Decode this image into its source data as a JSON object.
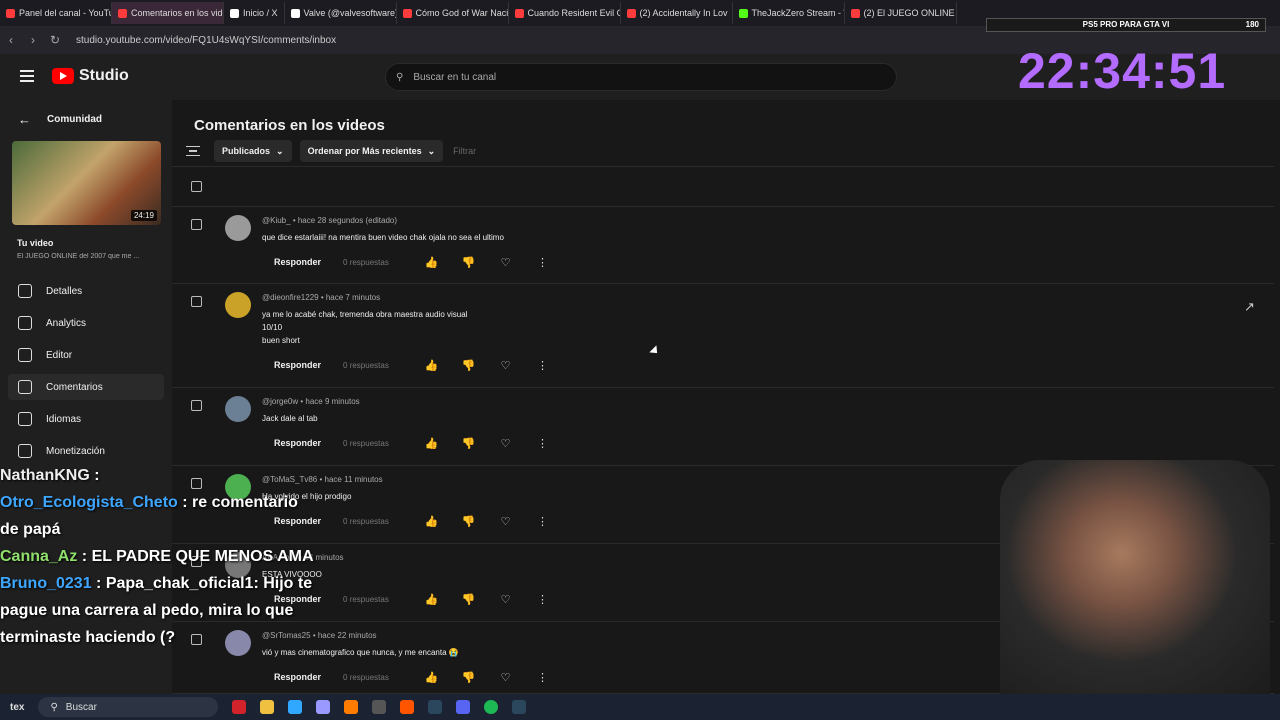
{
  "browser": {
    "tabs": [
      {
        "label": "Panel del canal - YouTube",
        "color": "#ff3b3b",
        "active": false
      },
      {
        "label": "Comentarios en los videos",
        "color": "#ff3b3b",
        "active": true
      },
      {
        "label": "Inicio / X",
        "color": "#ffffff",
        "active": false
      },
      {
        "label": "Valve (@valvesoftware) / X",
        "color": "#ffffff",
        "active": false
      },
      {
        "label": "Cómo God of War Nació",
        "color": "#ff3b3b",
        "active": false
      },
      {
        "label": "Cuando Resident Evil Cas",
        "color": "#ff3b3b",
        "active": false
      },
      {
        "label": "(2) Accidentally In Lov",
        "color": "#ff3b3b",
        "active": false
      },
      {
        "label": "TheJackZero Stream - Wa",
        "color": "#53fc18",
        "active": false
      },
      {
        "label": "(2) El JUEGO ONLINE del",
        "color": "#ff3b3b",
        "active": false
      }
    ],
    "url": "studio.youtube.com/video/FQ1U4sWqYSI/comments/inbox"
  },
  "topbar": {
    "logo_text": "Studio",
    "search_placeholder": "Buscar en tu canal"
  },
  "overlay": {
    "clock": "22:34:51",
    "banner": "PS5 PRO PARA GTA VI",
    "banner_count": "180"
  },
  "sidebar": {
    "back_label": "Comunidad",
    "thumb_duration": "24:19",
    "your_video_label": "Tu video",
    "video_title": "El JUEGO ONLINE del 2007 que me ...",
    "items": [
      {
        "label": "Detalles",
        "icon": "pencil-icon",
        "active": false
      },
      {
        "label": "Analytics",
        "icon": "analytics-icon",
        "active": false
      },
      {
        "label": "Editor",
        "icon": "editor-icon",
        "active": false
      },
      {
        "label": "Comentarios",
        "icon": "comment-icon",
        "active": true
      },
      {
        "label": "Idiomas",
        "icon": "languages-icon",
        "active": false
      },
      {
        "label": "Monetización",
        "icon": "dollar-icon",
        "active": false
      }
    ]
  },
  "main": {
    "title": "Comentarios en los videos",
    "chip_published": "Publicados",
    "chip_sort": "Ordenar por Más recientes",
    "filter_placeholder": "Filtrar",
    "reply_label": "Responder",
    "comments": [
      {
        "author": "@Kiub_",
        "time": "hace 28 segundos (editado)",
        "lines": [
          "que dice estarlaiii! na mentira buen video chak ojala no sea el ultimo"
        ],
        "replies": "0 respuestas",
        "avatar_color": "#9a9a9a"
      },
      {
        "author": "@dieonfire1229",
        "time": "hace 7 minutos",
        "lines": [
          "ya me lo acabé chak, tremenda obra maestra audio visual",
          "10/10",
          "buen short"
        ],
        "replies": "0 respuestas",
        "avatar_color": "#c9a227"
      },
      {
        "author": "@jorge0w",
        "time": "hace 9 minutos",
        "lines": [
          "Jack dale al tab"
        ],
        "replies": "0 respuestas",
        "avatar_color": "#6b7f95"
      },
      {
        "author": "@ToMaS_Tv86",
        "time": "hace 11 minutos",
        "lines": [
          "Ha volvido el hijo prodigo"
        ],
        "replies": "0 respuestas",
        "avatar_color": "#4caf50"
      },
      {
        "author": "AAA",
        "time": "hace 14 minutos",
        "lines": [
          "ESTA VIVOOOO"
        ],
        "replies": "0 respuestas",
        "avatar_color": "#777777"
      },
      {
        "author": "@SrTomas25",
        "time": "hace 22 minutos",
        "lines": [
          "vió y mas cinematografico que nunca, y me encanta 😭"
        ],
        "replies": "0 respuestas",
        "avatar_color": "#8888aa"
      }
    ]
  },
  "chat": [
    {
      "name": "NathanKNG",
      "msg": ""
    },
    {
      "name": "Otro_Ecologista_Cheto",
      "msg": "re comentario de papá"
    },
    {
      "name": "Canna_Az",
      "msg": "EL PADRE QUE MENOS AMA"
    },
    {
      "name": "Bruno_0231",
      "msg": "Papa_chak_oficial1: Hijo te pague una carrera al pedo, mira lo que terminaste haciendo (?"
    }
  ],
  "taskbar": {
    "search_label": "Buscar"
  }
}
